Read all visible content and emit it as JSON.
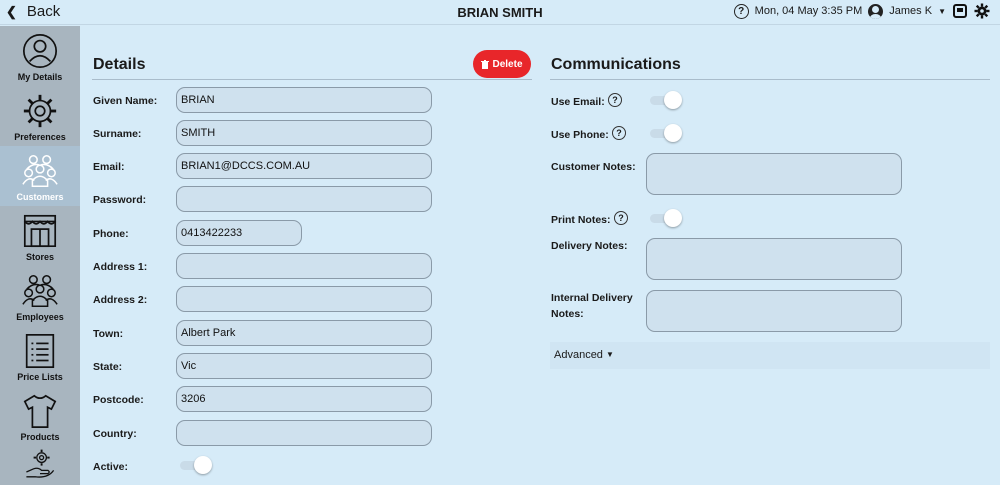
{
  "topbar": {
    "back_label": "Back",
    "title": "BRIAN SMITH",
    "datetime": "Mon, 04 May 3:35 PM",
    "user_name": "James K"
  },
  "sidebar": {
    "items": [
      {
        "label": "My Details",
        "icon": "user-circle-icon"
      },
      {
        "label": "Preferences",
        "icon": "gear-icon"
      },
      {
        "label": "Customers",
        "icon": "customers-group-icon",
        "active": true
      },
      {
        "label": "Stores",
        "icon": "store-icon"
      },
      {
        "label": "Employees",
        "icon": "employees-group-icon"
      },
      {
        "label": "Price Lists",
        "icon": "price-list-icon"
      },
      {
        "label": "Products",
        "icon": "tshirt-icon"
      },
      {
        "label": "",
        "icon": "hand-gear-icon"
      }
    ]
  },
  "details": {
    "title": "Details",
    "delete_label": "Delete",
    "fields": {
      "given_name": {
        "label": "Given Name:",
        "value": "BRIAN"
      },
      "surname": {
        "label": "Surname:",
        "value": "SMITH"
      },
      "email": {
        "label": "Email:",
        "value": "BRIAN1@DCCS.COM.AU"
      },
      "password": {
        "label": "Password:",
        "value": ""
      },
      "phone": {
        "label": "Phone:",
        "value": "0413422233"
      },
      "address1": {
        "label": "Address 1:",
        "value": ""
      },
      "address2": {
        "label": "Address 2:",
        "value": ""
      },
      "town": {
        "label": "Town:",
        "value": "Albert Park"
      },
      "state": {
        "label": "State:",
        "value": "Vic"
      },
      "postcode": {
        "label": "Postcode:",
        "value": "3206"
      },
      "country": {
        "label": "Country:",
        "value": ""
      }
    },
    "active_label": "Active:",
    "active_on": true
  },
  "communications": {
    "title": "Communications",
    "use_email_label": "Use Email:",
    "use_phone_label": "Use Phone:",
    "customer_notes_label": "Customer Notes:",
    "print_notes_label": "Print Notes:",
    "delivery_notes_label": "Delivery Notes:",
    "internal_delivery_label_1": "Internal Delivery",
    "internal_delivery_label_2": "Notes:",
    "advanced_label": "Advanced",
    "help_symbol": "?"
  },
  "colors": {
    "background": "#d6ebf8",
    "sidebar": "#a8b5bf",
    "delete": "#e8262a",
    "input_bg": "#cfe1ee"
  }
}
